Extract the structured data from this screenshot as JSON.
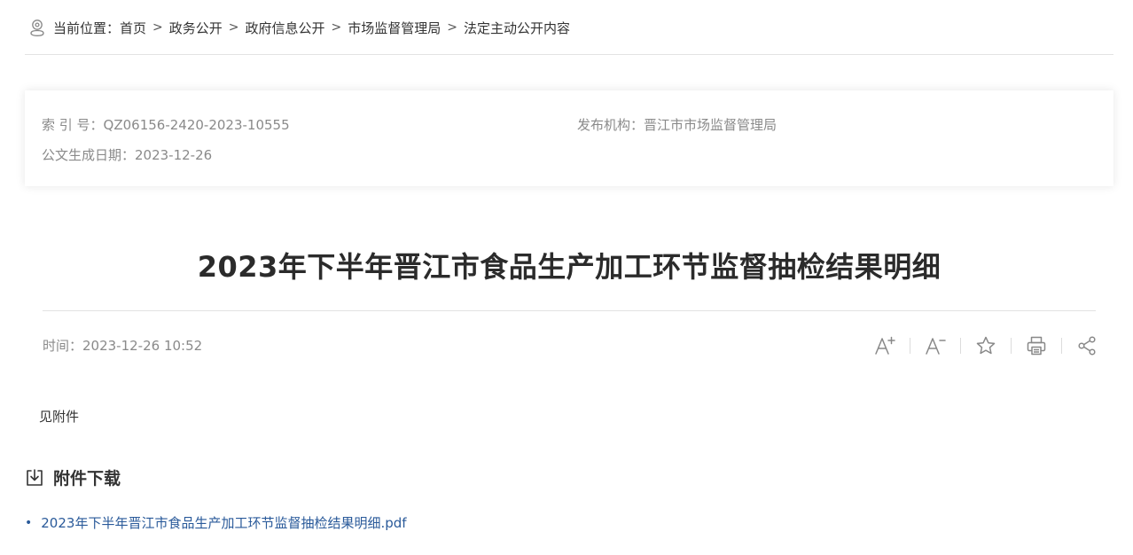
{
  "breadcrumb": {
    "prefix": "当前位置：",
    "separator": ">",
    "items": [
      {
        "label": "首页"
      },
      {
        "label": "政务公开"
      },
      {
        "label": "政府信息公开"
      },
      {
        "label": "市场监督管理局"
      },
      {
        "label": "法定主动公开内容"
      }
    ],
    "icon": "location-icon"
  },
  "info": {
    "index_no": "索 引 号：QZ06156-2420-2023-10555",
    "publisher": "发布机构：晋江市市场监督管理局",
    "date": "公文生成日期：2023-12-26"
  },
  "article": {
    "title": "2023年下半年晋江市食品生产加工环节监督抽检结果明细",
    "time": "时间：2023-12-26 10:52",
    "body": "见附件"
  },
  "tools": [
    {
      "name": "font-increase-icon",
      "label": "A+"
    },
    {
      "name": "font-decrease-icon",
      "label": "A-"
    },
    {
      "name": "star-icon",
      "label": "收藏"
    },
    {
      "name": "print-icon",
      "label": "打印"
    },
    {
      "name": "share-icon",
      "label": "分享"
    }
  ],
  "attachments": {
    "heading": "附件下载",
    "icon": "download-icon",
    "files": [
      {
        "name": "2023年下半年晋江市食品生产加工环节监督抽检结果明细.pdf"
      }
    ]
  },
  "colors": {
    "link": "#2a5a9a",
    "muted": "#8a8a8a",
    "title": "#2b2b2b"
  }
}
